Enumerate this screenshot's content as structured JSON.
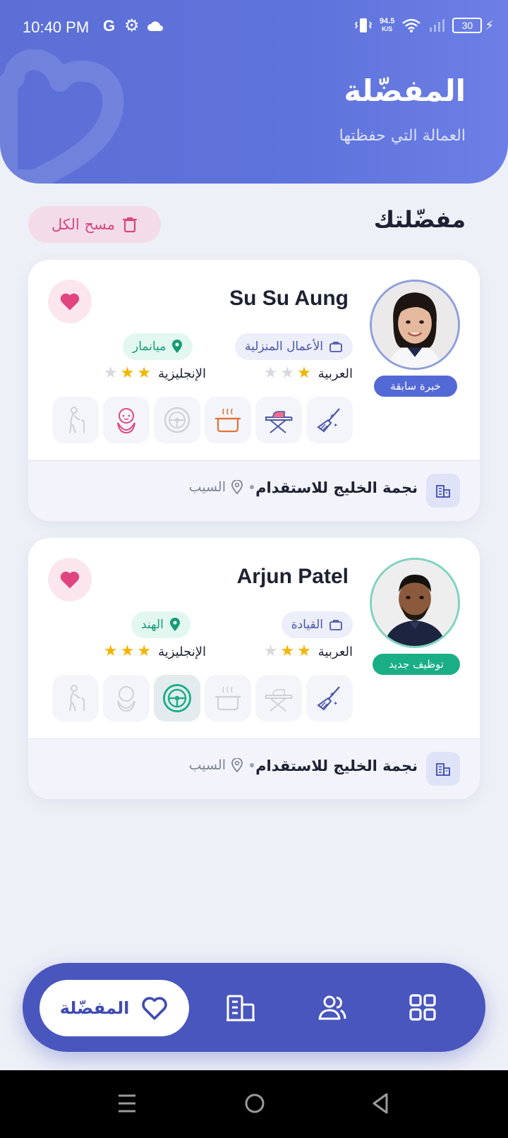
{
  "status_bar": {
    "time": "10:40 PM",
    "left_icons": [
      "google-icon",
      "gear-icon",
      "cloud-icon"
    ],
    "speed_value": "94.5",
    "speed_unit": "K/S",
    "battery": "30"
  },
  "header": {
    "title": "المفضّلة",
    "subtitle": "العمالة التي حفظتها"
  },
  "section": {
    "title": "مفضّلتك",
    "clear_label": "مسح الكل"
  },
  "workers": [
    {
      "name": "Su Su Aung",
      "badge": "خبرة سابقة",
      "job": "الأعمال المنزلية",
      "location": "ميانمار",
      "arabic_label": "العربية",
      "arabic_stars": 1,
      "english_label": "الإنجليزية",
      "english_stars": 2,
      "skills_active": [
        "cleaning",
        "ironing",
        "cooking",
        "babysitting"
      ],
      "agency": "نجمة الخليج للاستقدام",
      "city": "السيب"
    },
    {
      "name": "Arjun Patel",
      "badge": "توظيف جديد",
      "job": "القيادة",
      "location": "الهند",
      "arabic_label": "العربية",
      "arabic_stars": 2,
      "english_label": "الإنجليزية",
      "english_stars": 3,
      "skills_active": [
        "cleaning",
        "driving"
      ],
      "agency": "نجمة الخليج للاستقدام",
      "city": "السيب"
    }
  ],
  "bottom_nav": {
    "active_label": "المفضّلة",
    "items": [
      "favorites-icon",
      "agencies-icon",
      "workers-icon",
      "grid-icon"
    ]
  },
  "colors": {
    "primary": "#5b6fd6",
    "nav": "#4956bd",
    "pink": "#e0457f",
    "green": "#1aae86",
    "blue_badge": "#5369d6",
    "star": "#f5b400"
  }
}
